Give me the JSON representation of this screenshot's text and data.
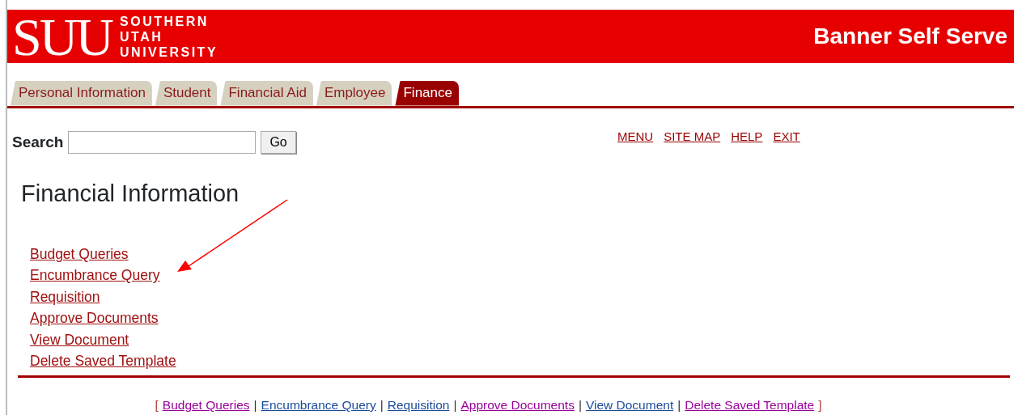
{
  "header": {
    "logo_mark": "SUU",
    "logo_lines": [
      "SOUTHERN",
      "UTAH",
      "UNIVERSITY"
    ],
    "title": "Banner Self Serve"
  },
  "tabs": [
    {
      "label": "Personal Information",
      "selected": false
    },
    {
      "label": "Student",
      "selected": false
    },
    {
      "label": "Financial Aid",
      "selected": false
    },
    {
      "label": "Employee",
      "selected": false
    },
    {
      "label": "Finance",
      "selected": true
    }
  ],
  "search": {
    "label": "Search",
    "button": "Go"
  },
  "top_links": [
    "MENU",
    "SITE MAP",
    "HELP",
    "EXIT"
  ],
  "page_title": "Financial Information",
  "menu_links": [
    "Budget Queries",
    "Encumbrance Query",
    "Requisition",
    "Approve Documents",
    "View Document",
    "Delete Saved Template"
  ],
  "footer": [
    {
      "kind": "bracket",
      "text": "["
    },
    {
      "kind": "link",
      "label": "Budget Queries",
      "visited": true
    },
    {
      "kind": "separator",
      "text": "|"
    },
    {
      "kind": "link",
      "label": "Encumbrance Query",
      "visited": false
    },
    {
      "kind": "separator",
      "text": "|"
    },
    {
      "kind": "link",
      "label": "Requisition",
      "visited": false
    },
    {
      "kind": "separator",
      "text": "|"
    },
    {
      "kind": "link",
      "label": "Approve Documents",
      "visited": true
    },
    {
      "kind": "separator",
      "text": "|"
    },
    {
      "kind": "link",
      "label": "View Document",
      "visited": false
    },
    {
      "kind": "separator",
      "text": "|"
    },
    {
      "kind": "link",
      "label": "Delete Saved Template",
      "visited": true
    },
    {
      "kind": "bracket",
      "text": "]"
    }
  ]
}
